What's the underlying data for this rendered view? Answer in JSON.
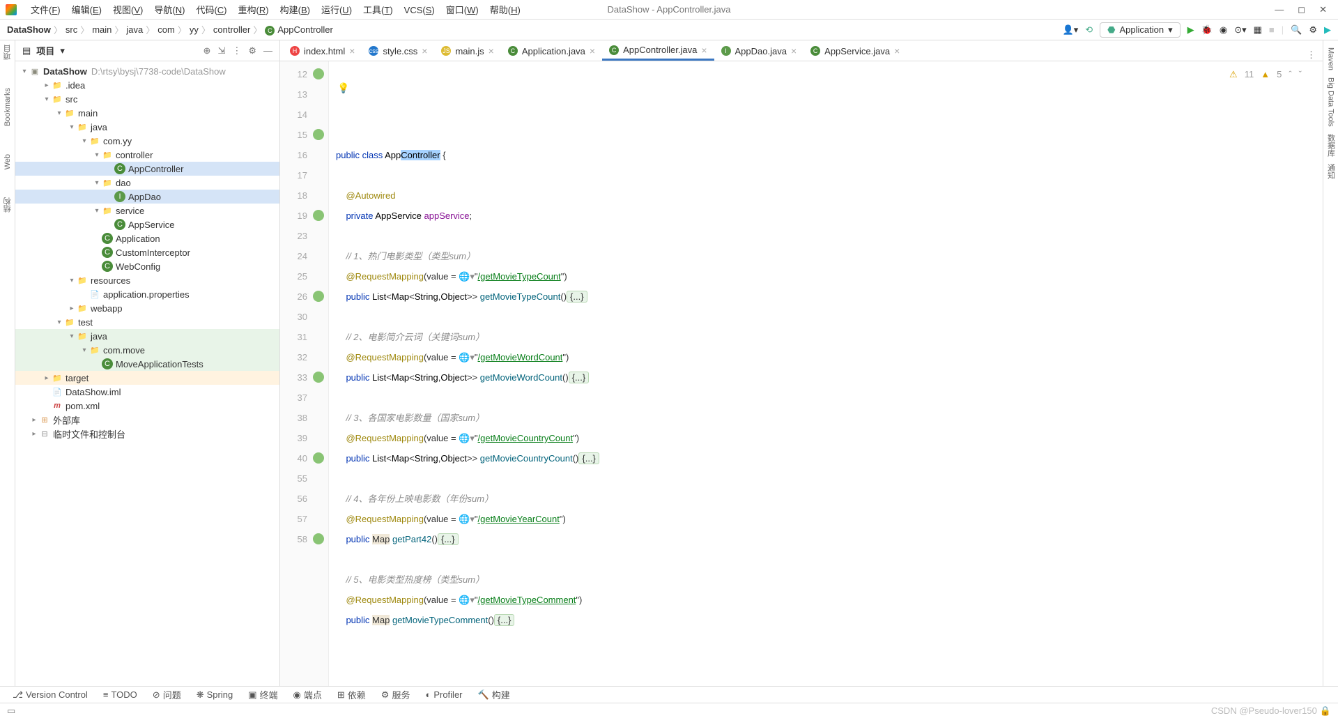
{
  "window": {
    "title": "DataShow - AppController.java"
  },
  "menu": [
    "文件(F)",
    "编辑(E)",
    "视图(V)",
    "导航(N)",
    "代码(C)",
    "重构(R)",
    "构建(B)",
    "运行(U)",
    "工具(T)",
    "VCS(S)",
    "窗口(W)",
    "帮助(H)"
  ],
  "breadcrumb": [
    "DataShow",
    "src",
    "main",
    "java",
    "com",
    "yy",
    "controller",
    "AppController"
  ],
  "runConfig": "Application",
  "projectPanel": {
    "title": "项目"
  },
  "tree": {
    "root": "DataShow",
    "rootPath": "D:\\rtsy\\bysj\\7738-code\\DataShow",
    "items": [
      {
        "d": 1,
        "a": ">",
        "i": "folder",
        "t": ".idea"
      },
      {
        "d": 1,
        "a": "v",
        "i": "folder",
        "t": "src"
      },
      {
        "d": 2,
        "a": "v",
        "i": "folder",
        "t": "main"
      },
      {
        "d": 3,
        "a": "v",
        "i": "folder-blue",
        "t": "java"
      },
      {
        "d": 4,
        "a": "v",
        "i": "folder",
        "t": "com.yy"
      },
      {
        "d": 5,
        "a": "v",
        "i": "folder",
        "t": "controller"
      },
      {
        "d": 6,
        "a": "",
        "i": "class-c",
        "t": "AppController",
        "sel": 1
      },
      {
        "d": 5,
        "a": "v",
        "i": "folder",
        "t": "dao"
      },
      {
        "d": 6,
        "a": "",
        "i": "class-i",
        "t": "AppDao",
        "sel": 2
      },
      {
        "d": 5,
        "a": "v",
        "i": "folder",
        "t": "service"
      },
      {
        "d": 6,
        "a": "",
        "i": "class-c",
        "t": "AppService"
      },
      {
        "d": 5,
        "a": "",
        "i": "class-c",
        "t": "Application"
      },
      {
        "d": 5,
        "a": "",
        "i": "class-c",
        "t": "CustomInterceptor"
      },
      {
        "d": 5,
        "a": "",
        "i": "class-c",
        "t": "WebConfig"
      },
      {
        "d": 3,
        "a": "v",
        "i": "folder",
        "t": "resources"
      },
      {
        "d": 4,
        "a": "",
        "i": "file",
        "t": "application.properties"
      },
      {
        "d": 3,
        "a": ">",
        "i": "folder",
        "t": "webapp"
      },
      {
        "d": 2,
        "a": "v",
        "i": "folder",
        "t": "test"
      },
      {
        "d": 3,
        "a": "v",
        "i": "folder-blue",
        "t": "java",
        "sel": 3
      },
      {
        "d": 4,
        "a": "v",
        "i": "folder",
        "t": "com.move",
        "sel": 3
      },
      {
        "d": 5,
        "a": "",
        "i": "class-c",
        "t": "MoveApplicationTests",
        "sel": 3
      },
      {
        "d": 1,
        "a": ">",
        "i": "folder-orange",
        "t": "target",
        "sel": 4
      },
      {
        "d": 1,
        "a": "",
        "i": "file",
        "t": "DataShow.iml"
      },
      {
        "d": 1,
        "a": "",
        "i": "file-m",
        "t": "pom.xml"
      },
      {
        "d": 0,
        "a": ">",
        "i": "lib",
        "t": "外部库"
      },
      {
        "d": 0,
        "a": ">",
        "i": "scratch",
        "t": "临时文件和控制台"
      }
    ]
  },
  "tabs": [
    {
      "icon": "html",
      "label": "index.html"
    },
    {
      "icon": "css",
      "label": "style.css"
    },
    {
      "icon": "js",
      "label": "main.js"
    },
    {
      "icon": "java",
      "label": "Application.java"
    },
    {
      "icon": "java",
      "label": "AppController.java",
      "active": true
    },
    {
      "icon": "java-i",
      "label": "AppDao.java"
    },
    {
      "icon": "java",
      "label": "AppService.java"
    }
  ],
  "warnings": {
    "w1": "11",
    "w2": "5"
  },
  "lines": [
    {
      "n": "12",
      "g": 1,
      "html": "<span class='kw'>public</span> <span class='kw'>class</span> <span class='cls'>App<span class='sel'>Controller</span></span> {"
    },
    {
      "n": "13",
      "html": ""
    },
    {
      "n": "14",
      "html": "    <span class='ann'>@Autowired</span>"
    },
    {
      "n": "15",
      "g": 1,
      "html": "    <span class='kw'>private</span> <span class='ty'>AppService</span> <span class='fld'>appService</span>;"
    },
    {
      "n": "16",
      "html": ""
    },
    {
      "n": "17",
      "html": "    <span class='cmt'>// 1、热门电影类型（类型sum）</span>"
    },
    {
      "n": "18",
      "html": "    <span class='ann'>@RequestMapping</span>(value = <span class='web-icon'>🌐▾</span>\"<span class='str'>/getMovieTypeCount</span>\")"
    },
    {
      "n": "19",
      "g": 1,
      "html": "    <span class='kw'>public</span> <span class='ty'>List</span>&lt;<span class='ty'>Map</span>&lt;<span class='ty'>String</span>,<span class='ty'>Object</span>&gt;&gt; <span class='mth'>getMovieTypeCount</span>()<span class='fold'>{...}</span>"
    },
    {
      "n": "23",
      "html": ""
    },
    {
      "n": "24",
      "html": "    <span class='cmt'>// 2、电影简介云词（关键词sum）</span>"
    },
    {
      "n": "25",
      "html": "    <span class='ann'>@RequestMapping</span>(value = <span class='web-icon'>🌐▾</span>\"<span class='str'>/getMovieWordCount</span>\")"
    },
    {
      "n": "26",
      "g": 1,
      "html": "    <span class='kw'>public</span> <span class='ty'>List</span>&lt;<span class='ty'>Map</span>&lt;<span class='ty'>String</span>,<span class='ty'>Object</span>&gt;&gt; <span class='mth'>getMovieWordCount</span>()<span class='fold'>{...}</span>"
    },
    {
      "n": "30",
      "html": ""
    },
    {
      "n": "31",
      "html": "    <span class='cmt'>// 3、各国家电影数量（国家sum）</span>"
    },
    {
      "n": "32",
      "html": "    <span class='ann'>@RequestMapping</span>(value = <span class='web-icon'>🌐▾</span>\"<span class='str'>/getMovieCountryCount</span>\")"
    },
    {
      "n": "33",
      "g": 1,
      "html": "    <span class='kw'>public</span> <span class='ty'>List</span>&lt;<span class='ty'>Map</span>&lt;<span class='ty'>String</span>,<span class='ty'>Object</span>&gt;&gt; <span class='mth'>getMovieCountryCount</span>()<span class='fold'>{...}</span>"
    },
    {
      "n": "37",
      "html": ""
    },
    {
      "n": "38",
      "html": "    <span class='cmt'>// 4、各年份上映电影数（年份sum）</span>"
    },
    {
      "n": "39",
      "html": "    <span class='ann'>@RequestMapping</span>(value = <span class='web-icon'>🌐▾</span>\"<span class='str'>/getMovieYearCount</span>\")"
    },
    {
      "n": "40",
      "g": 1,
      "html": "    <span class='kw'>public</span> <span style='background:#f0e8d8'>Map</span> <span class='mth'>getPart42</span>()<span class='fold'>{...}</span>"
    },
    {
      "n": "55",
      "html": ""
    },
    {
      "n": "56",
      "html": "    <span class='cmt'>// 5、电影类型热度榜（类型sum）</span>"
    },
    {
      "n": "57",
      "html": "    <span class='ann'>@RequestMapping</span>(value = <span class='web-icon'>🌐▾</span>\"<span class='str'>/getMovieTypeComment</span>\")"
    },
    {
      "n": "58",
      "g": 1,
      "html": "    <span class='kw'>public</span> <span style='background:#f0e8d8'>Map</span> <span class='mth'>getMovieTypeComment</span>()<span class='fold'>{...}</span>"
    }
  ],
  "bottomTabs": [
    "Version Control",
    "TODO",
    "问题",
    "Spring",
    "终端",
    "端点",
    "依赖",
    "服务",
    "Profiler",
    "构建"
  ],
  "leftGutter": [
    "项目",
    "Bookmarks",
    "Web",
    "结构"
  ],
  "rightGutter": [
    "Maven",
    "Big Data Tools",
    "数据库",
    "通知"
  ],
  "watermark": "CSDN @Pseudo-lover150"
}
